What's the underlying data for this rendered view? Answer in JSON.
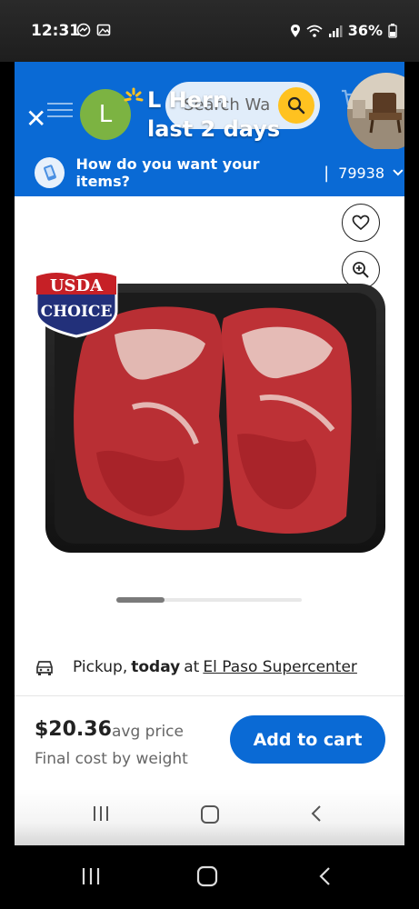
{
  "status_bar": {
    "time": "12:31",
    "battery": "36%"
  },
  "header": {
    "avatar_letter": "L",
    "search_placeholder": "Search Wa",
    "notification_title": "L Hern",
    "notification_subtitle": "last 2 days"
  },
  "delivery": {
    "question": "How do you want your items?",
    "separator": "|",
    "zip": "79938"
  },
  "product": {
    "badge_top": "USDA",
    "badge_bottom": "CHOICE"
  },
  "carousel": {
    "current_fraction": 0.26
  },
  "pickup": {
    "prefix": "Pickup,",
    "when": "today",
    "at": "at",
    "store": "El Paso Supercenter"
  },
  "price_block": {
    "price": "$20.36",
    "price_note": "avg price",
    "final_cost": "Final cost by weight",
    "add_to_cart": "Add to cart"
  },
  "colors": {
    "brand_blue": "#0a6ad5",
    "spark_yellow": "#ffc220",
    "avatar_green": "#7cb342"
  },
  "icons": [
    "close-icon",
    "menu-icon",
    "spark-icon",
    "search-icon",
    "cart-icon",
    "phone-bag-icon",
    "chevron-down-icon",
    "heart-icon",
    "zoom-in-icon",
    "car-icon",
    "recents-icon",
    "home-icon",
    "back-icon"
  ]
}
